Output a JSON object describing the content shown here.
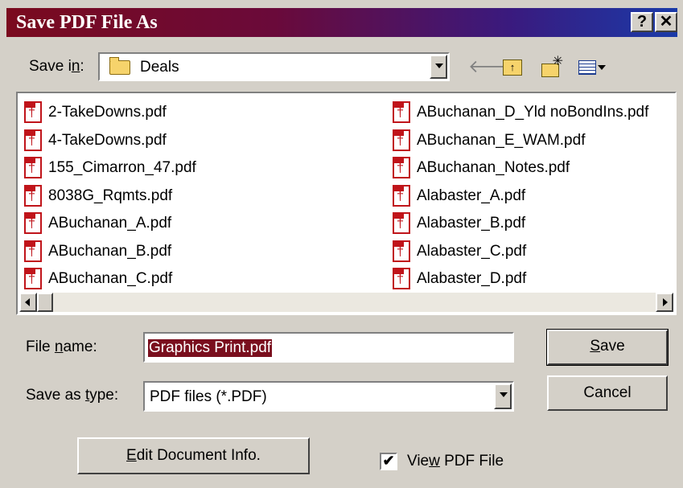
{
  "window": {
    "title": "Save PDF File As",
    "help_button": "?",
    "close_button": "✕"
  },
  "save_in": {
    "label": "Save in:",
    "value": "Deals"
  },
  "toolbar": {
    "icons": [
      "back-arrow-icon",
      "up-one-level-icon",
      "new-folder-icon",
      "view-menu-icon"
    ]
  },
  "files": {
    "column1": [
      "2-TakeDowns.pdf",
      "4-TakeDowns.pdf",
      "155_Cimarron_47.pdf",
      "8038G_Rqmts.pdf",
      "ABuchanan_A.pdf",
      "ABuchanan_B.pdf",
      "ABuchanan_C.pdf"
    ],
    "column2": [
      "ABuchanan_D_Yld noBondIns.pdf",
      "ABuchanan_E_WAM.pdf",
      "ABuchanan_Notes.pdf",
      "Alabaster_A.pdf",
      "Alabaster_B.pdf",
      "Alabaster_C.pdf",
      "Alabaster_D.pdf"
    ]
  },
  "form": {
    "file_name_label": "File name:",
    "file_name_value": "Graphics Print.pdf",
    "type_label": "Save as type:",
    "type_value": "PDF files (*.PDF)"
  },
  "buttons": {
    "save": "Save",
    "cancel": "Cancel",
    "edit_info": "Edit Document Info."
  },
  "view_pdf": {
    "label": "View PDF File",
    "checked": true,
    "check_mark": "✔"
  }
}
